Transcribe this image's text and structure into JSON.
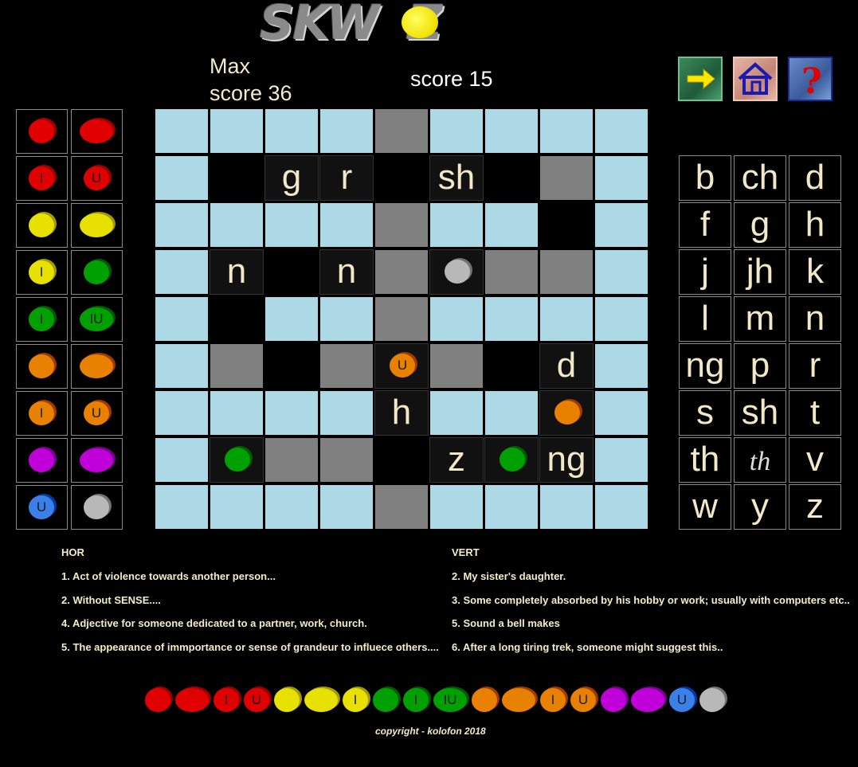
{
  "logo": {
    "text": "SKW Z"
  },
  "scores": {
    "max_line1": "Max",
    "max_line2": "score 36",
    "current": "score 15"
  },
  "toolbar": [
    {
      "name": "next-button",
      "icon": "arrow-right-icon"
    },
    {
      "name": "home-button",
      "icon": "home-icon"
    },
    {
      "name": "help-button",
      "icon": "question-icon"
    }
  ],
  "palette": [
    [
      {
        "color": "#e00000",
        "label": ""
      },
      {
        "color": "#e00000",
        "label": "",
        "wide": true
      }
    ],
    [
      {
        "color": "#e00000",
        "label": "I"
      },
      {
        "color": "#e00000",
        "label": "U"
      }
    ],
    [
      {
        "color": "#e8e000",
        "label": ""
      },
      {
        "color": "#e8e000",
        "label": "",
        "wide": true
      }
    ],
    [
      {
        "color": "#e8e000",
        "label": "I"
      },
      {
        "color": "#00a000",
        "label": ""
      }
    ],
    [
      {
        "color": "#00a000",
        "label": "I"
      },
      {
        "color": "#00a000",
        "label": "IU",
        "wide": true
      }
    ],
    [
      {
        "color": "#e88000",
        "label": ""
      },
      {
        "color": "#e88000",
        "label": "",
        "wide": true
      }
    ],
    [
      {
        "color": "#e88000",
        "label": "I"
      },
      {
        "color": "#e88000",
        "label": "U"
      }
    ],
    [
      {
        "color": "#c000d8",
        "label": ""
      },
      {
        "color": "#c000d8",
        "label": "",
        "wide": true
      }
    ],
    [
      {
        "color": "#3a80e8",
        "label": "U"
      },
      {
        "color": "#b8b8b8",
        "label": ""
      }
    ]
  ],
  "grid": [
    [
      "w",
      "w",
      "w",
      "w",
      "g",
      "w",
      "w",
      "w",
      "w"
    ],
    [
      "w",
      "b",
      {
        "t": "l",
        "v": "g"
      },
      {
        "t": "l",
        "v": "r"
      },
      "b",
      {
        "t": "l",
        "v": "sh"
      },
      "b",
      "g",
      "w"
    ],
    [
      "w",
      "w",
      "w",
      "w",
      "g",
      "w",
      "w",
      "b",
      "w"
    ],
    [
      "w",
      {
        "t": "l",
        "v": "n"
      },
      "b",
      {
        "t": "l",
        "v": "n"
      },
      "g",
      {
        "t": "blob",
        "color": "#b8b8b8",
        "label": ""
      },
      "g",
      "g",
      "w"
    ],
    [
      "w",
      "b",
      "w",
      "w",
      "g",
      "w",
      "w",
      "w",
      "w"
    ],
    [
      "w",
      "g",
      "b",
      "g",
      {
        "t": "blob",
        "color": "#e88000",
        "label": "U"
      },
      "g",
      "b",
      {
        "t": "l",
        "v": "d"
      },
      "w"
    ],
    [
      "w",
      "w",
      "w",
      "w",
      {
        "t": "l",
        "v": "h"
      },
      "w",
      "w",
      {
        "t": "blob",
        "color": "#e88000",
        "label": ""
      },
      "w"
    ],
    [
      "w",
      {
        "t": "blob",
        "color": "#00a000",
        "label": ""
      },
      "g",
      "g",
      "b",
      {
        "t": "l",
        "v": "z"
      },
      {
        "t": "blob",
        "color": "#00a000",
        "label": ""
      },
      {
        "t": "l",
        "v": "ng"
      },
      "w"
    ],
    [
      "w",
      "w",
      "w",
      "w",
      "g",
      "w",
      "w",
      "w",
      "w"
    ]
  ],
  "letters": [
    [
      "b",
      "ch",
      "d"
    ],
    [
      "f",
      "g",
      "h"
    ],
    [
      "j",
      "jh",
      "k"
    ],
    [
      "l",
      "m",
      "n"
    ],
    [
      "ng",
      "p",
      "r"
    ],
    [
      "s",
      "sh",
      "t"
    ],
    [
      "th",
      "th",
      "v"
    ],
    [
      "w",
      "y",
      "z"
    ]
  ],
  "letters_italic": [
    [
      6,
      1
    ]
  ],
  "clues": {
    "hor_title": "HOR",
    "vert_title": "VERT",
    "hor": [
      "1. Act of violence towards another person...",
      "2. Without SENSE....",
      "4. Adjective for someone dedicated to a partner, work, church.",
      "5. The appearance of immportance or sense of grandeur to influece others...."
    ],
    "vert": [
      "2. My sister's daughter.",
      "3. Some completely absorbed by his hobby or work; usually with computers etc..",
      "5. Sound a bell makes",
      "6. After a long tiring trek, someone might suggest this.."
    ]
  },
  "key_row": [
    {
      "color": "#e00000",
      "label": ""
    },
    {
      "color": "#e00000",
      "label": "",
      "wide": true
    },
    {
      "color": "#e00000",
      "label": "I"
    },
    {
      "color": "#e00000",
      "label": "U"
    },
    {
      "color": "#e8e000",
      "label": ""
    },
    {
      "color": "#e8e000",
      "label": "",
      "wide": true
    },
    {
      "color": "#e8e000",
      "label": "I"
    },
    {
      "color": "#00a000",
      "label": ""
    },
    {
      "color": "#00a000",
      "label": "I"
    },
    {
      "color": "#00a000",
      "label": "IU",
      "wide": true
    },
    {
      "color": "#e88000",
      "label": ""
    },
    {
      "color": "#e88000",
      "label": "",
      "wide": true
    },
    {
      "color": "#e88000",
      "label": "I"
    },
    {
      "color": "#e88000",
      "label": "U"
    },
    {
      "color": "#c000d8",
      "label": ""
    },
    {
      "color": "#c000d8",
      "label": "",
      "wide": true
    },
    {
      "color": "#3a80e8",
      "label": "U"
    },
    {
      "color": "#b8b8b8",
      "label": ""
    }
  ],
  "footer": {
    "copyright": "copyright - kolofon 2018"
  }
}
